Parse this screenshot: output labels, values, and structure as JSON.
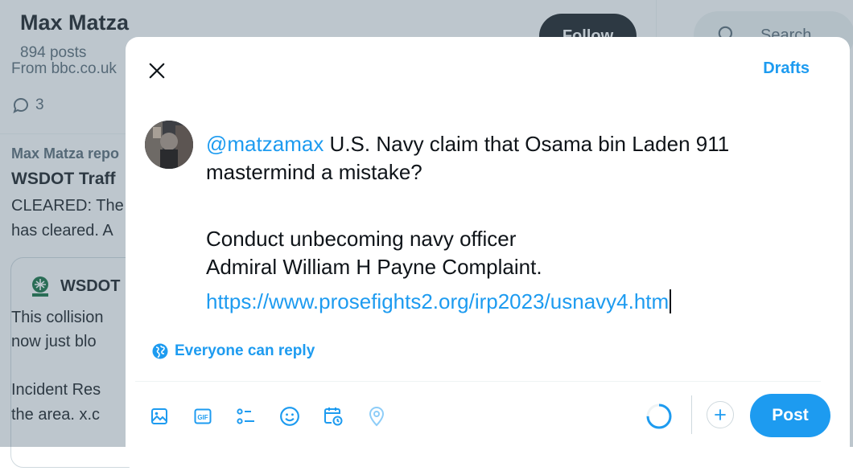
{
  "background": {
    "profile_name": "Max Matza",
    "post_count": "894 posts",
    "follow_label": "Follow",
    "search_placeholder": "Search",
    "source_text": "From bbc.co.uk",
    "reply_count": "3",
    "repost_text": "Max Matza repo",
    "post_title": "WSDOT Traff",
    "post_lines": [
      "CLEARED: The",
      "has cleared. A"
    ],
    "card_name": "WSDOT",
    "card_lines": [
      "This collision",
      "now just blo",
      "Incident Res",
      "the area.  x.c"
    ],
    "colors": {
      "text": "#0f1419",
      "muted": "#536471",
      "overlay": "rgba(91,112,131,0.40)"
    }
  },
  "modal": {
    "close_icon": "close-icon",
    "drafts_label": "Drafts",
    "avatar_icon": "avatar-photo",
    "composer": {
      "mention": "@matzamax",
      "line1_rest": " U.S. Navy claim that Osama bin Laden 911",
      "line2": "mastermind a mistake?",
      "line3": "Conduct unbecoming navy officer",
      "line4": "Admiral William H Payne Complaint.",
      "link": "https://www.prosefights2.org/irp2023/usnavy4.htm"
    },
    "reply_setting": {
      "icon": "globe-icon",
      "label": "Everyone can reply"
    },
    "toolbar": {
      "icons": [
        "image-icon",
        "gif-icon",
        "poll-icon",
        "emoji-icon",
        "schedule-icon",
        "location-icon"
      ],
      "progress_icon": "character-progress-ring",
      "add_icon": "plus-icon",
      "post_label": "Post"
    },
    "colors": {
      "accent": "#1d9bf0",
      "divider": "#eff3f4",
      "border": "#cfd9de"
    }
  }
}
